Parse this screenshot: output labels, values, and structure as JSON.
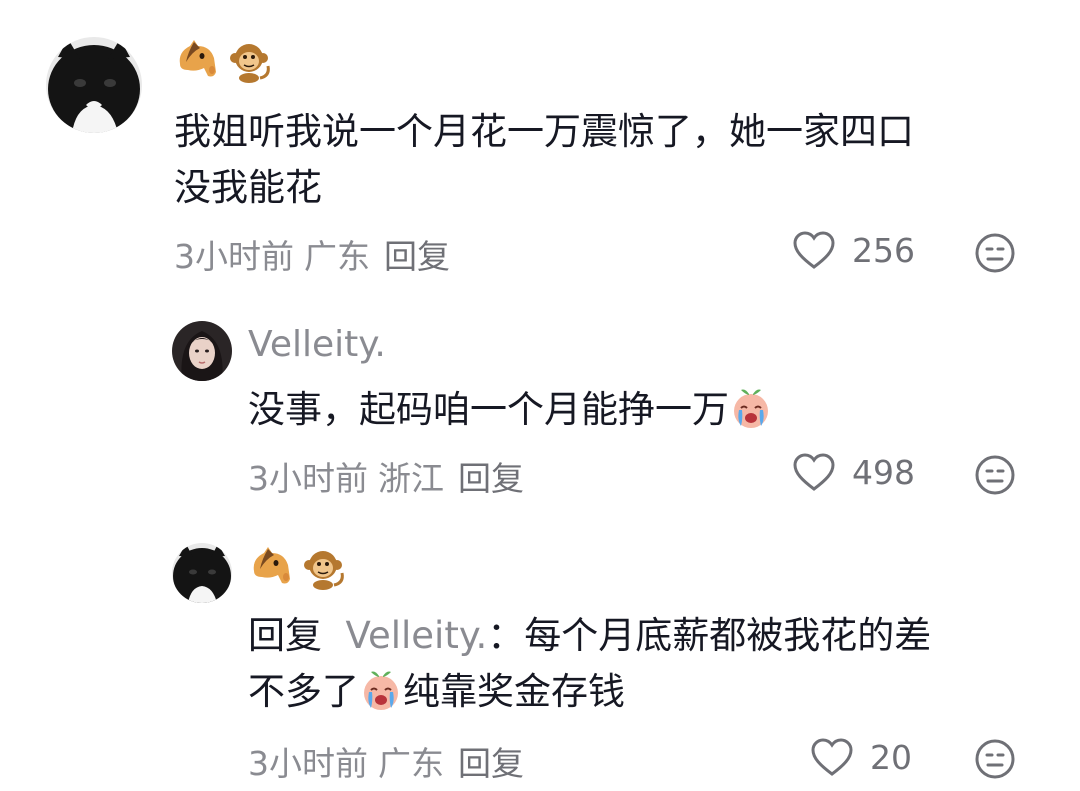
{
  "comments": [
    {
      "avatar_icon": "black-white-cat-avatar",
      "username_emojis": [
        "horse-face-icon",
        "monkey-icon"
      ],
      "text_line1": "我姐听我说一个月花一万震惊了，她一家四口",
      "text_line2": "没我能花",
      "time": "3小时前",
      "location": "广东",
      "reply_label": "回复",
      "likes": "256"
    },
    {
      "avatar_icon": "girl-portrait-avatar",
      "username": "Velleity.",
      "text": "没事，起码咱一个月能挣一万",
      "text_emoji": "crying-peach-emoji",
      "time": "3小时前",
      "location": "浙江",
      "reply_label": "回复",
      "likes": "498"
    },
    {
      "avatar_icon": "black-white-cat-avatar",
      "username_emojis": [
        "horse-face-icon",
        "monkey-icon"
      ],
      "reply_prefix": "回复",
      "reply_target": "Velleity.",
      "reply_colon": "：",
      "text_line1": "每个月底薪都被我花的差",
      "text_line2a": "不多了",
      "text_emoji": "crying-peach-emoji",
      "text_line2b": "纯靠奖金存钱",
      "time": "3小时前",
      "location": "广东",
      "reply_label": "回复",
      "likes": "20"
    }
  ],
  "colors": {
    "text_primary": "#161823",
    "text_secondary": "#8a8b91",
    "icon_gray": "#6f7076"
  }
}
